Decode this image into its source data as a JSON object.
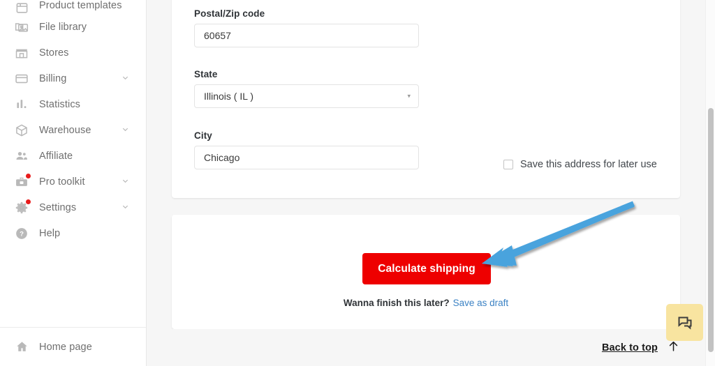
{
  "sidebar": {
    "items": [
      {
        "label": "Product templates",
        "icon": "product-templates-icon",
        "chevron": false,
        "dot": false,
        "partial": true
      },
      {
        "label": "File library",
        "icon": "file-library-icon",
        "chevron": false,
        "dot": false
      },
      {
        "label": "Stores",
        "icon": "stores-icon",
        "chevron": false,
        "dot": false
      },
      {
        "label": "Billing",
        "icon": "billing-card-icon",
        "chevron": true,
        "dot": false
      },
      {
        "label": "Statistics",
        "icon": "statistics-bars-icon",
        "chevron": false,
        "dot": false
      },
      {
        "label": "Warehouse",
        "icon": "warehouse-box-icon",
        "chevron": true,
        "dot": false
      },
      {
        "label": "Affiliate",
        "icon": "affiliate-people-icon",
        "chevron": false,
        "dot": false
      },
      {
        "label": "Pro toolkit",
        "icon": "pro-toolkit-icon",
        "chevron": true,
        "dot": true
      },
      {
        "label": "Settings",
        "icon": "settings-gear-icon",
        "chevron": true,
        "dot": true
      },
      {
        "label": "Help",
        "icon": "help-question-icon",
        "chevron": false,
        "dot": false
      }
    ],
    "footer": {
      "label": "Home page",
      "icon": "home-icon"
    }
  },
  "address_form": {
    "postal": {
      "label": "Postal/Zip code",
      "value": "60657",
      "placeholder": "Postal/Zip code"
    },
    "state": {
      "label": "State",
      "value": "Illinois ( IL )",
      "caret": "▾"
    },
    "city": {
      "label": "City",
      "value": "Chicago",
      "placeholder": "City"
    },
    "save_address": {
      "label": "Save this address for later use",
      "checked": false
    }
  },
  "actions": {
    "calculate_label": "Calculate shipping",
    "draft_question": "Wanna finish this later?",
    "draft_link": "Save as draft"
  },
  "footer": {
    "back_to_top": "Back to top",
    "back_to_top_icon": "arrow-up-icon"
  },
  "chat": {
    "icon": "chat-bubbles-icon"
  },
  "colors": {
    "primary_red": "#ee0000",
    "link_blue": "#3b82c4",
    "chat_yellow": "#f8e4a0",
    "badge_red": "#e81c1c",
    "annotation_blue": "#4aa3dd",
    "page_bg": "#f6f6f6"
  }
}
